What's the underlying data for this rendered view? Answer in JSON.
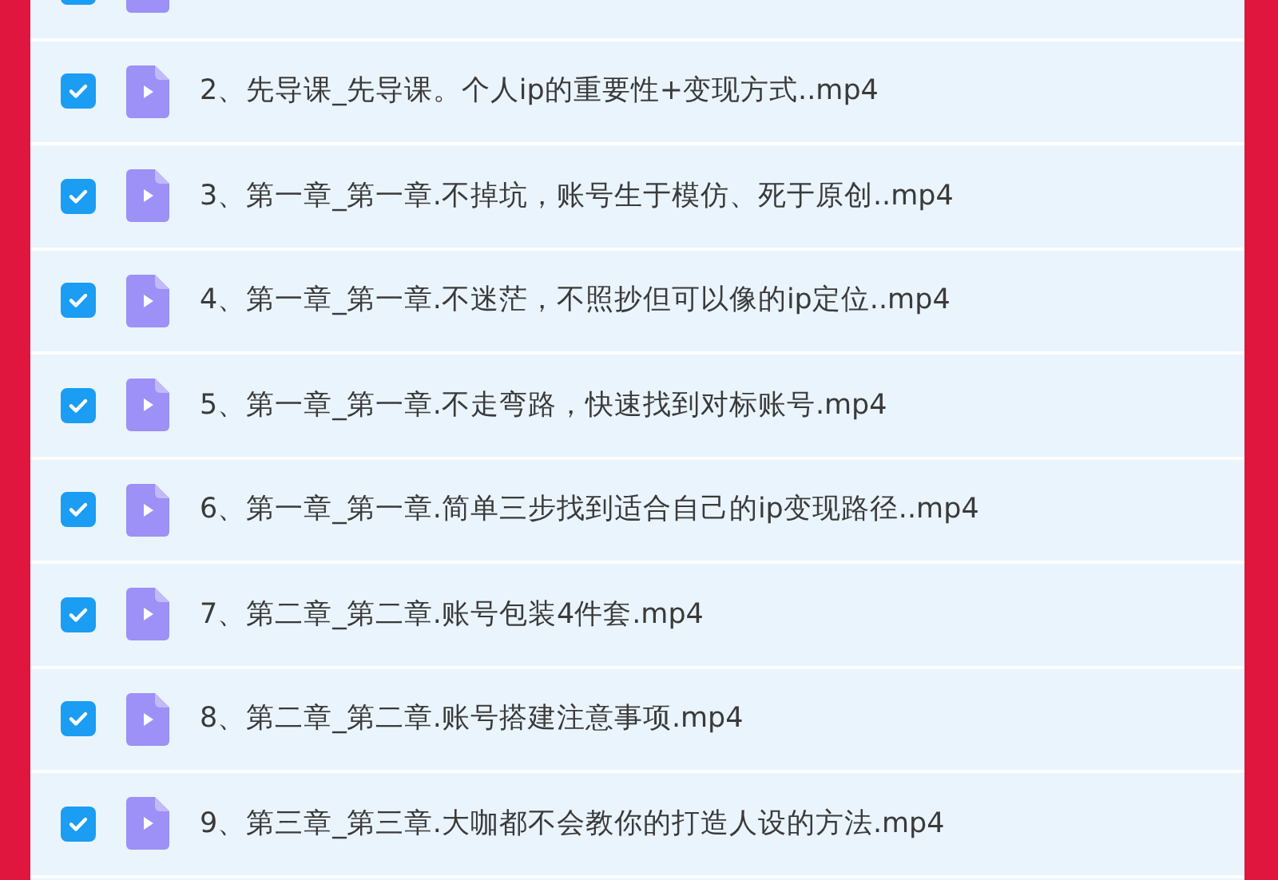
{
  "files": [
    {
      "checked": true
    },
    {
      "checked": true,
      "name": "2、先导课_先导课。个人ip的重要性+变现方式..mp4"
    },
    {
      "checked": true,
      "name": "3、第一章_第一章.不掉坑，账号生于模仿、死于原创..mp4"
    },
    {
      "checked": true,
      "name": "4、第一章_第一章.不迷茫，不照抄但可以像的ip定位..mp4"
    },
    {
      "checked": true,
      "name": "5、第一章_第一章.不走弯路，快速找到对标账号.mp4"
    },
    {
      "checked": true,
      "name": "6、第一章_第一章.简单三步找到适合自己的ip变现路径..mp4"
    },
    {
      "checked": true,
      "name": "7、第二章_第二章.账号包装4件套.mp4"
    },
    {
      "checked": true,
      "name": "8、第二章_第二章.账号搭建注意事项.mp4"
    },
    {
      "checked": true,
      "name": "9、第三章_第三章.大咖都不会教你的打造人设的方法.mp4"
    }
  ]
}
